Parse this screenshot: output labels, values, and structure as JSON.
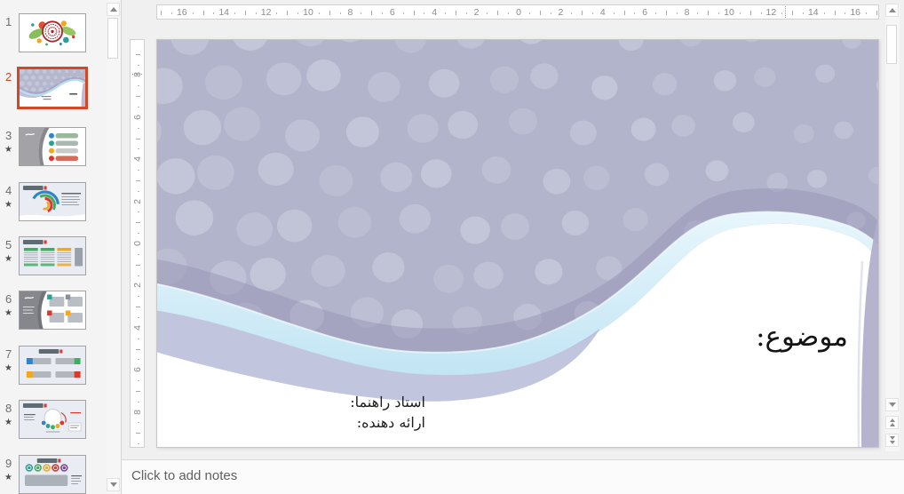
{
  "slide_panel": {
    "star_glyph": "★",
    "thumbnails": [
      {
        "number": "1",
        "starred": false,
        "selected": false,
        "variant": "title-art"
      },
      {
        "number": "2",
        "starred": false,
        "selected": true,
        "variant": "wave"
      },
      {
        "number": "3",
        "starred": true,
        "selected": false,
        "variant": "list"
      },
      {
        "number": "4",
        "starred": true,
        "selected": false,
        "variant": "arcs"
      },
      {
        "number": "5",
        "starred": true,
        "selected": false,
        "variant": "tables"
      },
      {
        "number": "6",
        "starred": true,
        "selected": false,
        "variant": "grid"
      },
      {
        "number": "7",
        "starred": true,
        "selected": false,
        "variant": "bars"
      },
      {
        "number": "8",
        "starred": true,
        "selected": false,
        "variant": "cycle"
      },
      {
        "number": "9",
        "starred": true,
        "selected": false,
        "variant": "badges"
      }
    ]
  },
  "rulers": {
    "horizontal_labels": [
      "16",
      "14",
      "12",
      "10",
      "8",
      "6",
      "4",
      "2",
      "0",
      "2",
      "4",
      "6",
      "8",
      "10",
      "12",
      "14",
      "16"
    ],
    "vertical_labels": [
      "8",
      "6",
      "4",
      "2",
      "0",
      "2",
      "4",
      "6",
      "8"
    ]
  },
  "slide": {
    "title": "موضوع:",
    "credits": [
      "استاد راهنما:",
      "ارائه دهنده:"
    ]
  },
  "notes": {
    "placeholder": "Click to add notes"
  },
  "colors": {
    "selection": "#d24726",
    "slide_bg": "#b2b4cb",
    "slide_dot": "#c4c8da",
    "wave_blue_light": "#e8f6fc",
    "wave_blue": "#c2e5f4",
    "wave_dark_band": "#8f89b0",
    "wave_under_band": "#b6bbd7",
    "wave_right_strip": "#b2afcc",
    "accent_palette": [
      "#2e86c8",
      "#3fae62",
      "#2aa198",
      "#f2a71e",
      "#d8392b",
      "#7a4a9e"
    ]
  }
}
